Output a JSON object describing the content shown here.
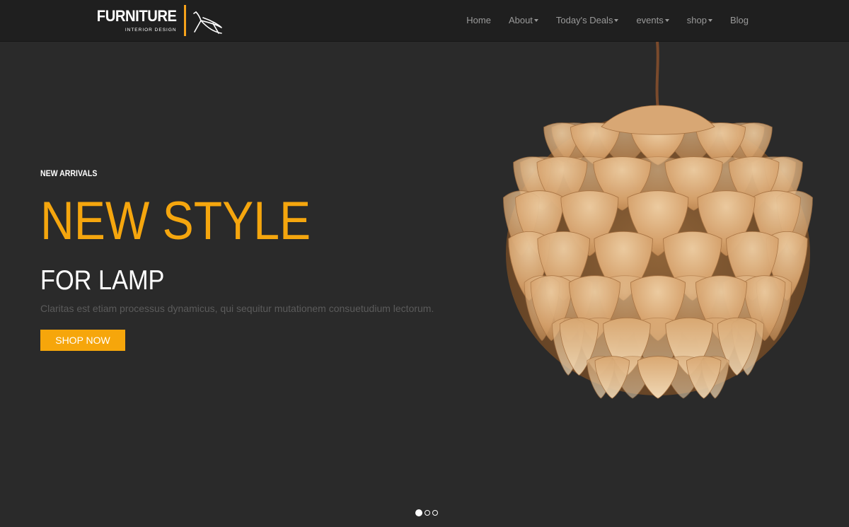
{
  "header": {
    "logo": {
      "main": "FURNITURE",
      "sub": "INTERIOR DESIGN"
    },
    "nav": [
      {
        "label": "Home",
        "dropdown": false
      },
      {
        "label": "About",
        "dropdown": true
      },
      {
        "label": "Today's Deals",
        "dropdown": true
      },
      {
        "label": "events",
        "dropdown": true
      },
      {
        "label": "shop",
        "dropdown": true
      },
      {
        "label": "Blog",
        "dropdown": false
      }
    ]
  },
  "hero": {
    "eyebrow": "NEW ARRIVALS",
    "title": "NEW STYLE",
    "subtitle": "FOR LAMP",
    "description": "Claritas est etiam processus dynamicus, qui sequitur mutationem consuetudium lectorum.",
    "cta_label": "SHOP NOW",
    "image": "wooden-pinecone-pendant-lamp"
  },
  "slider": {
    "slide_count": 3,
    "active_index": 0
  },
  "colors": {
    "accent": "#f5a60e",
    "background": "#2a2a2a",
    "header_bg": "#1f1f1f",
    "nav_text": "#9a9a9a",
    "description_text": "#5b5b5b"
  }
}
